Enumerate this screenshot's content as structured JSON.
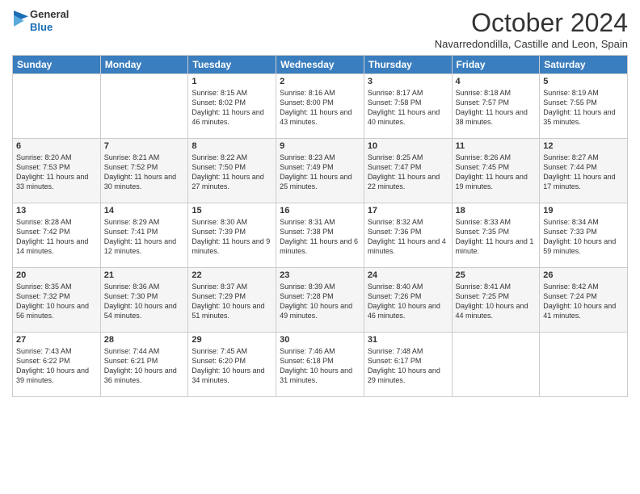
{
  "logo": {
    "general": "General",
    "blue": "Blue"
  },
  "header": {
    "month": "October 2024",
    "location": "Navarredondilla, Castille and Leon, Spain"
  },
  "days_of_week": [
    "Sunday",
    "Monday",
    "Tuesday",
    "Wednesday",
    "Thursday",
    "Friday",
    "Saturday"
  ],
  "weeks": [
    [
      {
        "num": "",
        "info": ""
      },
      {
        "num": "",
        "info": ""
      },
      {
        "num": "1",
        "info": "Sunrise: 8:15 AM\nSunset: 8:02 PM\nDaylight: 11 hours and 46 minutes."
      },
      {
        "num": "2",
        "info": "Sunrise: 8:16 AM\nSunset: 8:00 PM\nDaylight: 11 hours and 43 minutes."
      },
      {
        "num": "3",
        "info": "Sunrise: 8:17 AM\nSunset: 7:58 PM\nDaylight: 11 hours and 40 minutes."
      },
      {
        "num": "4",
        "info": "Sunrise: 8:18 AM\nSunset: 7:57 PM\nDaylight: 11 hours and 38 minutes."
      },
      {
        "num": "5",
        "info": "Sunrise: 8:19 AM\nSunset: 7:55 PM\nDaylight: 11 hours and 35 minutes."
      }
    ],
    [
      {
        "num": "6",
        "info": "Sunrise: 8:20 AM\nSunset: 7:53 PM\nDaylight: 11 hours and 33 minutes."
      },
      {
        "num": "7",
        "info": "Sunrise: 8:21 AM\nSunset: 7:52 PM\nDaylight: 11 hours and 30 minutes."
      },
      {
        "num": "8",
        "info": "Sunrise: 8:22 AM\nSunset: 7:50 PM\nDaylight: 11 hours and 27 minutes."
      },
      {
        "num": "9",
        "info": "Sunrise: 8:23 AM\nSunset: 7:49 PM\nDaylight: 11 hours and 25 minutes."
      },
      {
        "num": "10",
        "info": "Sunrise: 8:25 AM\nSunset: 7:47 PM\nDaylight: 11 hours and 22 minutes."
      },
      {
        "num": "11",
        "info": "Sunrise: 8:26 AM\nSunset: 7:45 PM\nDaylight: 11 hours and 19 minutes."
      },
      {
        "num": "12",
        "info": "Sunrise: 8:27 AM\nSunset: 7:44 PM\nDaylight: 11 hours and 17 minutes."
      }
    ],
    [
      {
        "num": "13",
        "info": "Sunrise: 8:28 AM\nSunset: 7:42 PM\nDaylight: 11 hours and 14 minutes."
      },
      {
        "num": "14",
        "info": "Sunrise: 8:29 AM\nSunset: 7:41 PM\nDaylight: 11 hours and 12 minutes."
      },
      {
        "num": "15",
        "info": "Sunrise: 8:30 AM\nSunset: 7:39 PM\nDaylight: 11 hours and 9 minutes."
      },
      {
        "num": "16",
        "info": "Sunrise: 8:31 AM\nSunset: 7:38 PM\nDaylight: 11 hours and 6 minutes."
      },
      {
        "num": "17",
        "info": "Sunrise: 8:32 AM\nSunset: 7:36 PM\nDaylight: 11 hours and 4 minutes."
      },
      {
        "num": "18",
        "info": "Sunrise: 8:33 AM\nSunset: 7:35 PM\nDaylight: 11 hours and 1 minute."
      },
      {
        "num": "19",
        "info": "Sunrise: 8:34 AM\nSunset: 7:33 PM\nDaylight: 10 hours and 59 minutes."
      }
    ],
    [
      {
        "num": "20",
        "info": "Sunrise: 8:35 AM\nSunset: 7:32 PM\nDaylight: 10 hours and 56 minutes."
      },
      {
        "num": "21",
        "info": "Sunrise: 8:36 AM\nSunset: 7:30 PM\nDaylight: 10 hours and 54 minutes."
      },
      {
        "num": "22",
        "info": "Sunrise: 8:37 AM\nSunset: 7:29 PM\nDaylight: 10 hours and 51 minutes."
      },
      {
        "num": "23",
        "info": "Sunrise: 8:39 AM\nSunset: 7:28 PM\nDaylight: 10 hours and 49 minutes."
      },
      {
        "num": "24",
        "info": "Sunrise: 8:40 AM\nSunset: 7:26 PM\nDaylight: 10 hours and 46 minutes."
      },
      {
        "num": "25",
        "info": "Sunrise: 8:41 AM\nSunset: 7:25 PM\nDaylight: 10 hours and 44 minutes."
      },
      {
        "num": "26",
        "info": "Sunrise: 8:42 AM\nSunset: 7:24 PM\nDaylight: 10 hours and 41 minutes."
      }
    ],
    [
      {
        "num": "27",
        "info": "Sunrise: 7:43 AM\nSunset: 6:22 PM\nDaylight: 10 hours and 39 minutes."
      },
      {
        "num": "28",
        "info": "Sunrise: 7:44 AM\nSunset: 6:21 PM\nDaylight: 10 hours and 36 minutes."
      },
      {
        "num": "29",
        "info": "Sunrise: 7:45 AM\nSunset: 6:20 PM\nDaylight: 10 hours and 34 minutes."
      },
      {
        "num": "30",
        "info": "Sunrise: 7:46 AM\nSunset: 6:18 PM\nDaylight: 10 hours and 31 minutes."
      },
      {
        "num": "31",
        "info": "Sunrise: 7:48 AM\nSunset: 6:17 PM\nDaylight: 10 hours and 29 minutes."
      },
      {
        "num": "",
        "info": ""
      },
      {
        "num": "",
        "info": ""
      }
    ]
  ]
}
